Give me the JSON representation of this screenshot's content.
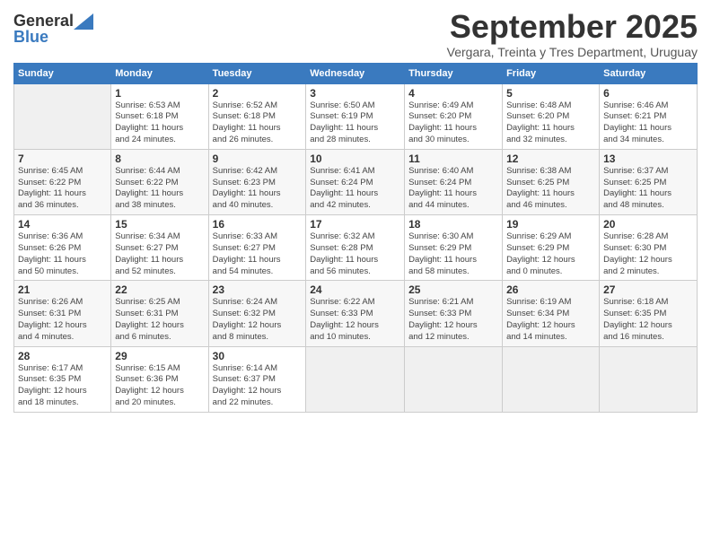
{
  "logo": {
    "line1": "General",
    "line2": "Blue"
  },
  "title": "September 2025",
  "subtitle": "Vergara, Treinta y Tres Department, Uruguay",
  "headers": [
    "Sunday",
    "Monday",
    "Tuesday",
    "Wednesday",
    "Thursday",
    "Friday",
    "Saturday"
  ],
  "weeks": [
    [
      {
        "day": "",
        "info": ""
      },
      {
        "day": "1",
        "info": "Sunrise: 6:53 AM\nSunset: 6:18 PM\nDaylight: 11 hours\nand 24 minutes."
      },
      {
        "day": "2",
        "info": "Sunrise: 6:52 AM\nSunset: 6:18 PM\nDaylight: 11 hours\nand 26 minutes."
      },
      {
        "day": "3",
        "info": "Sunrise: 6:50 AM\nSunset: 6:19 PM\nDaylight: 11 hours\nand 28 minutes."
      },
      {
        "day": "4",
        "info": "Sunrise: 6:49 AM\nSunset: 6:20 PM\nDaylight: 11 hours\nand 30 minutes."
      },
      {
        "day": "5",
        "info": "Sunrise: 6:48 AM\nSunset: 6:20 PM\nDaylight: 11 hours\nand 32 minutes."
      },
      {
        "day": "6",
        "info": "Sunrise: 6:46 AM\nSunset: 6:21 PM\nDaylight: 11 hours\nand 34 minutes."
      }
    ],
    [
      {
        "day": "7",
        "info": "Sunrise: 6:45 AM\nSunset: 6:22 PM\nDaylight: 11 hours\nand 36 minutes."
      },
      {
        "day": "8",
        "info": "Sunrise: 6:44 AM\nSunset: 6:22 PM\nDaylight: 11 hours\nand 38 minutes."
      },
      {
        "day": "9",
        "info": "Sunrise: 6:42 AM\nSunset: 6:23 PM\nDaylight: 11 hours\nand 40 minutes."
      },
      {
        "day": "10",
        "info": "Sunrise: 6:41 AM\nSunset: 6:24 PM\nDaylight: 11 hours\nand 42 minutes."
      },
      {
        "day": "11",
        "info": "Sunrise: 6:40 AM\nSunset: 6:24 PM\nDaylight: 11 hours\nand 44 minutes."
      },
      {
        "day": "12",
        "info": "Sunrise: 6:38 AM\nSunset: 6:25 PM\nDaylight: 11 hours\nand 46 minutes."
      },
      {
        "day": "13",
        "info": "Sunrise: 6:37 AM\nSunset: 6:25 PM\nDaylight: 11 hours\nand 48 minutes."
      }
    ],
    [
      {
        "day": "14",
        "info": "Sunrise: 6:36 AM\nSunset: 6:26 PM\nDaylight: 11 hours\nand 50 minutes."
      },
      {
        "day": "15",
        "info": "Sunrise: 6:34 AM\nSunset: 6:27 PM\nDaylight: 11 hours\nand 52 minutes."
      },
      {
        "day": "16",
        "info": "Sunrise: 6:33 AM\nSunset: 6:27 PM\nDaylight: 11 hours\nand 54 minutes."
      },
      {
        "day": "17",
        "info": "Sunrise: 6:32 AM\nSunset: 6:28 PM\nDaylight: 11 hours\nand 56 minutes."
      },
      {
        "day": "18",
        "info": "Sunrise: 6:30 AM\nSunset: 6:29 PM\nDaylight: 11 hours\nand 58 minutes."
      },
      {
        "day": "19",
        "info": "Sunrise: 6:29 AM\nSunset: 6:29 PM\nDaylight: 12 hours\nand 0 minutes."
      },
      {
        "day": "20",
        "info": "Sunrise: 6:28 AM\nSunset: 6:30 PM\nDaylight: 12 hours\nand 2 minutes."
      }
    ],
    [
      {
        "day": "21",
        "info": "Sunrise: 6:26 AM\nSunset: 6:31 PM\nDaylight: 12 hours\nand 4 minutes."
      },
      {
        "day": "22",
        "info": "Sunrise: 6:25 AM\nSunset: 6:31 PM\nDaylight: 12 hours\nand 6 minutes."
      },
      {
        "day": "23",
        "info": "Sunrise: 6:24 AM\nSunset: 6:32 PM\nDaylight: 12 hours\nand 8 minutes."
      },
      {
        "day": "24",
        "info": "Sunrise: 6:22 AM\nSunset: 6:33 PM\nDaylight: 12 hours\nand 10 minutes."
      },
      {
        "day": "25",
        "info": "Sunrise: 6:21 AM\nSunset: 6:33 PM\nDaylight: 12 hours\nand 12 minutes."
      },
      {
        "day": "26",
        "info": "Sunrise: 6:19 AM\nSunset: 6:34 PM\nDaylight: 12 hours\nand 14 minutes."
      },
      {
        "day": "27",
        "info": "Sunrise: 6:18 AM\nSunset: 6:35 PM\nDaylight: 12 hours\nand 16 minutes."
      }
    ],
    [
      {
        "day": "28",
        "info": "Sunrise: 6:17 AM\nSunset: 6:35 PM\nDaylight: 12 hours\nand 18 minutes."
      },
      {
        "day": "29",
        "info": "Sunrise: 6:15 AM\nSunset: 6:36 PM\nDaylight: 12 hours\nand 20 minutes."
      },
      {
        "day": "30",
        "info": "Sunrise: 6:14 AM\nSunset: 6:37 PM\nDaylight: 12 hours\nand 22 minutes."
      },
      {
        "day": "",
        "info": ""
      },
      {
        "day": "",
        "info": ""
      },
      {
        "day": "",
        "info": ""
      },
      {
        "day": "",
        "info": ""
      }
    ]
  ]
}
